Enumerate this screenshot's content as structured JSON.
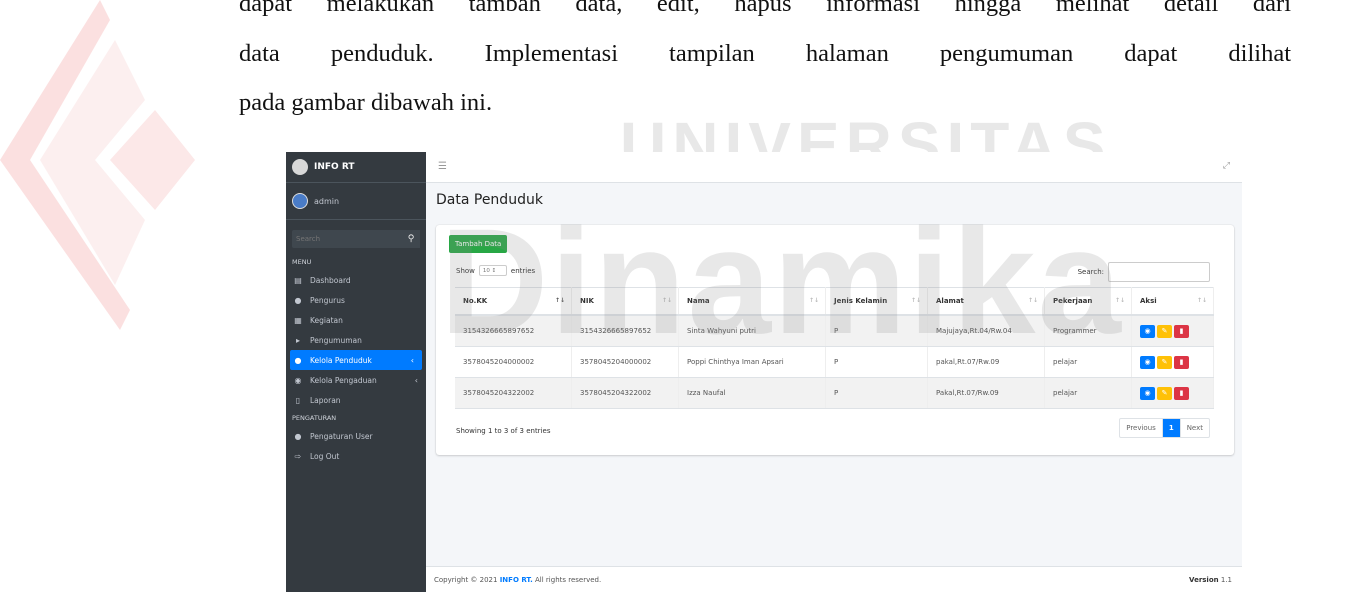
{
  "document": {
    "line1": "dapat melakukan tambah data, edit, hapus informasi hingga melihat detail dari",
    "line2": "data penduduk. Implementasi tampilan halaman pengumuman dapat dilihat",
    "line3": "pada gambar dibawah ini."
  },
  "watermark": {
    "word1": "UNIVERSITAS",
    "word2": "Dinamika"
  },
  "app": {
    "brand": "INFO RT",
    "user": "admin",
    "search_placeholder": "Search",
    "menu_header": "MENU",
    "menu": [
      {
        "label": "Dashboard",
        "icon": "chart-icon"
      },
      {
        "label": "Pengurus",
        "icon": "user-icon"
      },
      {
        "label": "Kegiatan",
        "icon": "bed-icon"
      },
      {
        "label": "Pengumuman",
        "icon": "megaphone-icon"
      },
      {
        "label": "Kelola Penduduk",
        "icon": "users-icon",
        "active": true
      },
      {
        "label": "Kelola Pengaduan",
        "icon": "comments-icon"
      },
      {
        "label": "Laporan",
        "icon": "file-icon"
      }
    ],
    "settings_header": "PENGATURAN",
    "settings": [
      {
        "label": "Pengaturan User",
        "icon": "user-cog-icon"
      },
      {
        "label": "Log Out",
        "icon": "logout-icon"
      }
    ],
    "page_title": "Data Penduduk",
    "add_button": "Tambah Data",
    "length": {
      "show": "Show",
      "value": "10",
      "entries": "entries"
    },
    "search_label": "Search:",
    "table": {
      "headers": [
        "No.KK",
        "NIK",
        "Nama",
        "Jenis Kelamin",
        "Alamat",
        "Pekerjaan",
        "Aksi"
      ],
      "rows": [
        [
          "3154326665897652",
          "3154326665897652",
          "Sinta Wahyuni putri",
          "P",
          "Majujaya,Rt.04/Rw.04",
          "Programmer"
        ],
        [
          "3578045204000002",
          "3578045204000002",
          "Poppi Chinthya Iman Apsari",
          "P",
          "pakal,Rt.07/Rw.09",
          "pelajar"
        ],
        [
          "3578045204322002",
          "3578045204322002",
          "Izza Naufal",
          "P",
          "Pakal,Rt.07/Rw.09",
          "pelajar"
        ]
      ]
    },
    "info": "Showing 1 to 3 of 3 entries",
    "pager": {
      "prev": "Previous",
      "page": "1",
      "next": "Next"
    },
    "footer": {
      "copy_prefix": "Copyright © 2021 ",
      "copy_brand": "INFO RT.",
      "copy_suffix": " All rights reserved.",
      "version_label": "Version",
      "version": "1.1"
    }
  }
}
